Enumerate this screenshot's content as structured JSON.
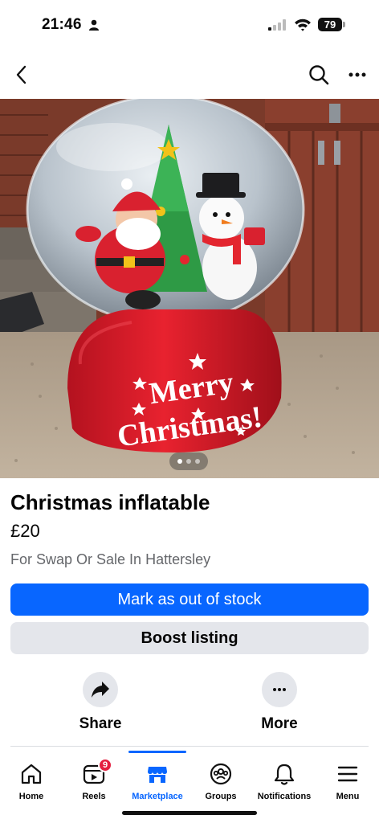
{
  "status_bar": {
    "time": "21:46",
    "battery": "79"
  },
  "top_nav": {
    "back_icon": "chevron-left-icon",
    "search_icon": "search-icon",
    "more_icon": "ellipsis-icon"
  },
  "photo": {
    "banner_line1": "Merry",
    "banner_line2": "Christmas!",
    "carousel_count": 3,
    "carousel_active": 1
  },
  "listing": {
    "title": "Christmas inflatable",
    "price": "£20",
    "location": "For Swap Or Sale In Hattersley"
  },
  "buttons": {
    "primary": "Mark as out of stock",
    "secondary": "Boost listing"
  },
  "actions": {
    "share_label": "Share",
    "more_label": "More"
  },
  "tab_bar": {
    "items": [
      {
        "label": "Home",
        "icon": "home-icon"
      },
      {
        "label": "Reels",
        "icon": "reels-icon",
        "badge": "9"
      },
      {
        "label": "Marketplace",
        "icon": "marketplace-icon",
        "active": true
      },
      {
        "label": "Groups",
        "icon": "groups-icon"
      },
      {
        "label": "Notifications",
        "icon": "bell-icon"
      },
      {
        "label": "Menu",
        "icon": "menu-icon"
      }
    ]
  },
  "colors": {
    "accent": "#0866ff",
    "badge": "#e41e3f",
    "secondary_button": "#e4e6eb"
  }
}
